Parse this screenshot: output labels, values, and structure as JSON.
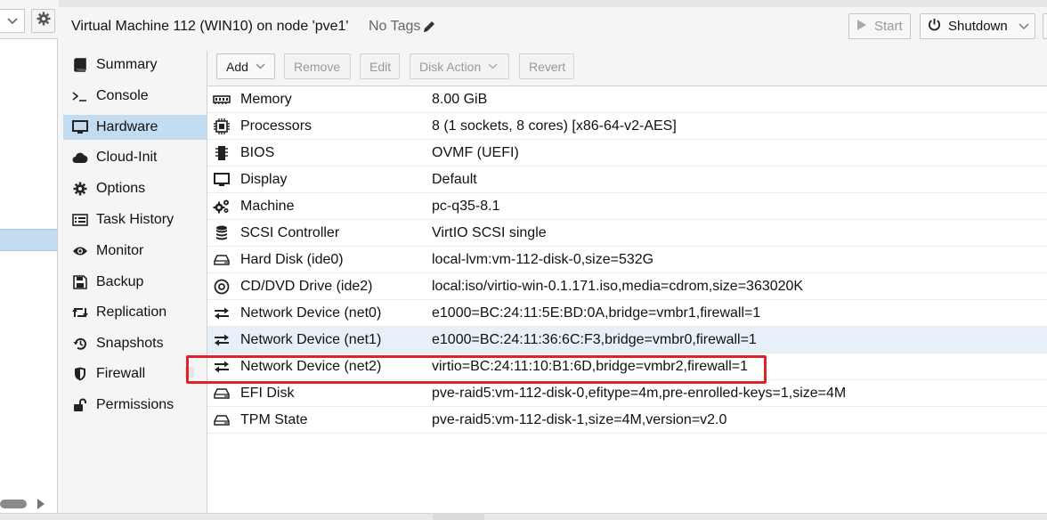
{
  "tree": {
    "view_select_icon": "chevron-down-icon",
    "gear_icon": "gear-icon"
  },
  "header": {
    "title": "Virtual Machine 112 (WIN10) on node 'pve1'",
    "tags": "No Tags",
    "start_label": "Start",
    "shutdown_label": "Shutdown"
  },
  "nav": {
    "items": [
      {
        "label": "Summary",
        "icon": "book-icon"
      },
      {
        "label": "Console",
        "icon": "terminal-icon"
      },
      {
        "label": "Hardware",
        "icon": "monitor-icon"
      },
      {
        "label": "Cloud-Init",
        "icon": "cloud-icon"
      },
      {
        "label": "Options",
        "icon": "gear-icon"
      },
      {
        "label": "Task History",
        "icon": "list-icon"
      },
      {
        "label": "Monitor",
        "icon": "eye-icon"
      },
      {
        "label": "Backup",
        "icon": "floppy-icon"
      },
      {
        "label": "Replication",
        "icon": "retweet-icon"
      },
      {
        "label": "Snapshots",
        "icon": "history-icon"
      },
      {
        "label": "Firewall",
        "icon": "shield-icon"
      },
      {
        "label": "Permissions",
        "icon": "unlock-icon"
      }
    ],
    "active": "Hardware"
  },
  "toolbar": {
    "add_label": "Add",
    "remove_label": "Remove",
    "edit_label": "Edit",
    "disk_action_label": "Disk Action",
    "revert_label": "Revert"
  },
  "hardware": [
    {
      "name": "Memory",
      "value": "8.00 GiB",
      "icon": "memory-icon"
    },
    {
      "name": "Processors",
      "value": "8 (1 sockets, 8 cores) [x86-64-v2-AES]",
      "icon": "cpu-icon"
    },
    {
      "name": "BIOS",
      "value": "OVMF (UEFI)",
      "icon": "microchip-icon"
    },
    {
      "name": "Display",
      "value": "Default",
      "icon": "desktop-icon"
    },
    {
      "name": "Machine",
      "value": "pc-q35-8.1",
      "icon": "cogs-icon"
    },
    {
      "name": "SCSI Controller",
      "value": "VirtIO SCSI single",
      "icon": "database-icon"
    },
    {
      "name": "Hard Disk (ide0)",
      "value": "local-lvm:vm-112-disk-0,size=532G",
      "icon": "hdd-icon"
    },
    {
      "name": "CD/DVD Drive (ide2)",
      "value": "local:iso/virtio-win-0.1.171.iso,media=cdrom,size=363020K",
      "icon": "cdrom-icon"
    },
    {
      "name": "Network Device (net0)",
      "value": "e1000=BC:24:11:5E:BD:0A,bridge=vmbr1,firewall=1",
      "icon": "exchange-icon"
    },
    {
      "name": "Network Device (net1)",
      "value": "e1000=BC:24:11:36:6C:F3,bridge=vmbr0,firewall=1",
      "icon": "exchange-icon"
    },
    {
      "name": "Network Device (net2)",
      "value": "virtio=BC:24:11:10:B1:6D,bridge=vmbr2,firewall=1",
      "icon": "exchange-icon"
    },
    {
      "name": "EFI Disk",
      "value": "pve-raid5:vm-112-disk-0,efitype=4m,pre-enrolled-keys=1,size=4M",
      "icon": "hdd-icon"
    },
    {
      "name": "TPM State",
      "value": "pve-raid5:vm-112-disk-1,size=4M,version=v2.0",
      "icon": "hdd-icon"
    }
  ],
  "selected_row": "Network Device (net1)",
  "highlighted_row": "Network Device (net2)",
  "colors": {
    "selection": "#c2ddf2",
    "row_selected": "#e7f0f8",
    "highlight_box": "#e0202a"
  }
}
